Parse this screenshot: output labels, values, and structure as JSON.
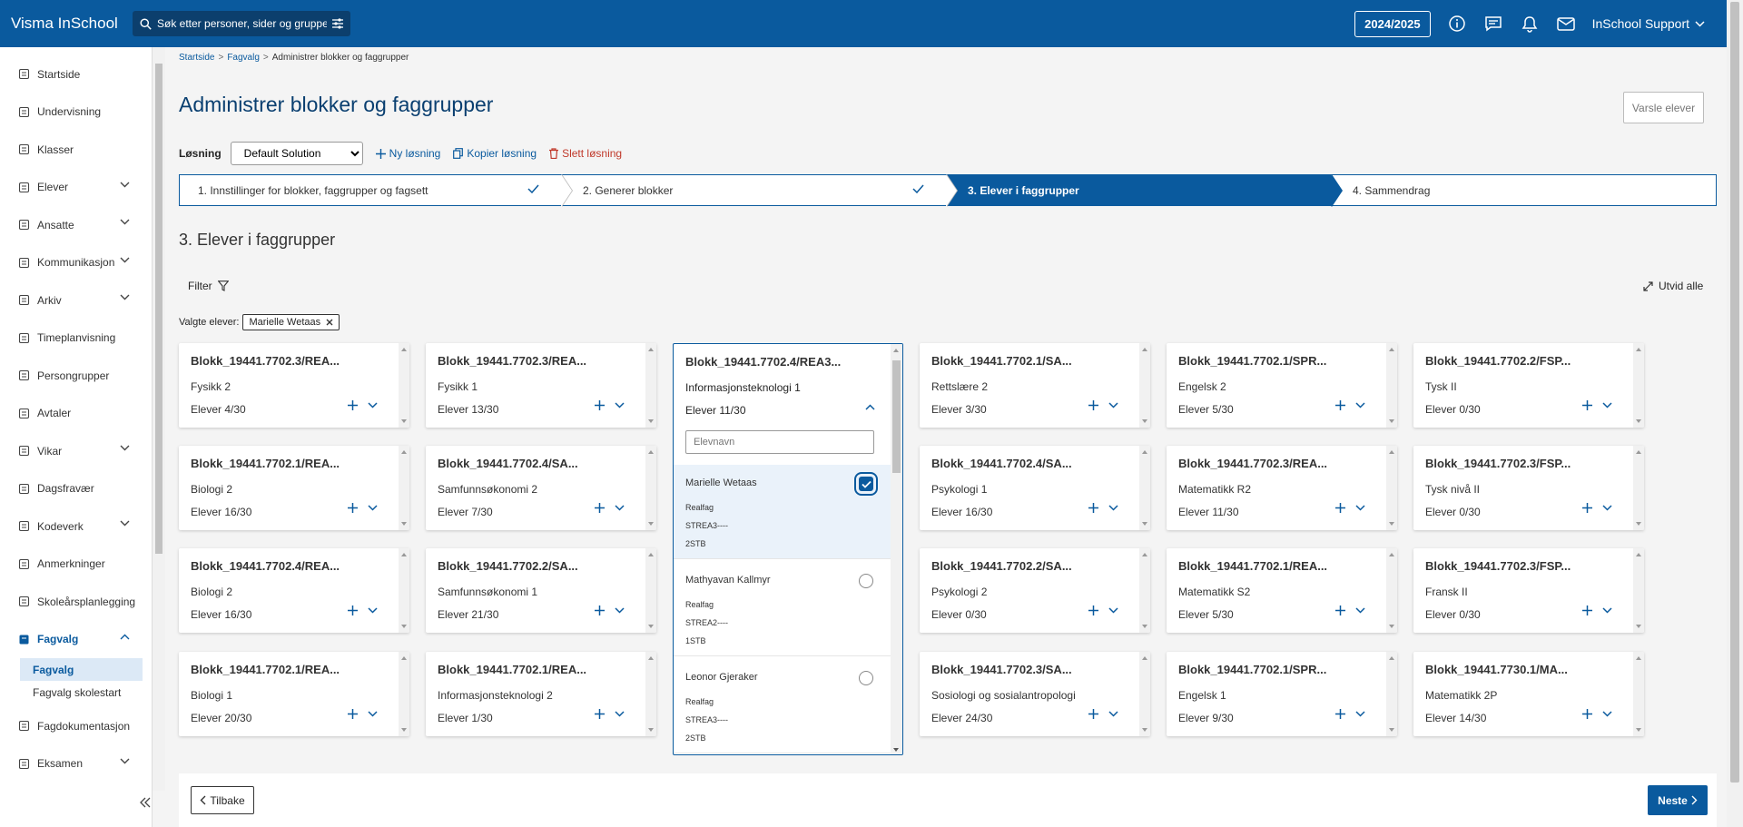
{
  "app": {
    "title": "Visma InSchool",
    "search_placeholder": "Søk etter personer, sider og grupper",
    "year": "2024/2025",
    "user": "InSchool Support"
  },
  "sidebar": {
    "items": [
      {
        "label": "Startside",
        "icon": "flag-icon",
        "chevron": false
      },
      {
        "label": "Undervisning",
        "icon": "book-icon",
        "chevron": false
      },
      {
        "label": "Klasser",
        "icon": "class-icon",
        "chevron": false
      },
      {
        "label": "Elever",
        "icon": "student-icon",
        "chevron": true
      },
      {
        "label": "Ansatte",
        "icon": "briefcase-icon",
        "chevron": true
      },
      {
        "label": "Kommunikasjon",
        "icon": "chat-icon",
        "chevron": true
      },
      {
        "label": "Arkiv",
        "icon": "archive-icon",
        "chevron": true
      },
      {
        "label": "Timeplanvisning",
        "icon": "calendar-icon",
        "chevron": false
      },
      {
        "label": "Persongrupper",
        "icon": "group-icon",
        "chevron": false
      },
      {
        "label": "Avtaler",
        "icon": "calendar-check-icon",
        "chevron": false
      },
      {
        "label": "Vikar",
        "icon": "swap-icon",
        "chevron": true
      },
      {
        "label": "Dagsfravær",
        "icon": "person-icon",
        "chevron": false
      },
      {
        "label": "Kodeverk",
        "icon": "code-icon",
        "chevron": true
      },
      {
        "label": "Anmerkninger",
        "icon": "hand-icon",
        "chevron": false
      },
      {
        "label": "Skoleårsplanlegging",
        "icon": "planner-icon",
        "chevron": false
      }
    ],
    "fagvalg": {
      "label": "Fagvalg",
      "subs": [
        "Fagvalg",
        "Fagvalg skolestart"
      ]
    },
    "after": [
      {
        "label": "Fagdokumentasjon",
        "icon": "document-icon",
        "chevron": false
      },
      {
        "label": "Eksamen",
        "icon": "exam-icon",
        "chevron": true
      }
    ]
  },
  "breadcrumb": [
    "Startside",
    "Fagvalg",
    "Administrer blokker og faggrupper"
  ],
  "page": {
    "title": "Administrer blokker og faggrupper",
    "varsle": "Varsle elever",
    "section": "3. Elever i faggrupper",
    "filter": "Filter",
    "expand": "Utvid alle",
    "valgte_label": "Valgte elever:",
    "valgte_chip": "Marielle Wetaas"
  },
  "solution": {
    "label": "Løsning",
    "value": "Default Solution",
    "new": "Ny løsning",
    "copy": "Kopier løsning",
    "delete": "Slett løsning"
  },
  "steps": [
    {
      "label": "1. Innstillinger for blokker, faggrupper og fagsett",
      "done": true
    },
    {
      "label": "2. Generer blokker",
      "done": true
    },
    {
      "label": "3. Elever i faggrupper",
      "done": false
    },
    {
      "label": "4. Sammendrag",
      "done": false
    }
  ],
  "cards": [
    [
      {
        "title": "Blokk_19441.7702.3/REA...",
        "subject": "Fysikk 2",
        "count": "Elever 4/30"
      },
      {
        "title": "Blokk_19441.7702.1/REA...",
        "subject": "Biologi 2",
        "count": "Elever 16/30"
      },
      {
        "title": "Blokk_19441.7702.4/REA...",
        "subject": "Biologi 2",
        "count": "Elever 16/30"
      },
      {
        "title": "Blokk_19441.7702.1/REA...",
        "subject": "Biologi 1",
        "count": "Elever 20/30"
      }
    ],
    [
      {
        "title": "Blokk_19441.7702.3/REA...",
        "subject": "Fysikk 1",
        "count": "Elever 13/30"
      },
      {
        "title": "Blokk_19441.7702.4/SA...",
        "subject": "Samfunnsøkonomi 2",
        "count": "Elever 7/30"
      },
      {
        "title": "Blokk_19441.7702.2/SA...",
        "subject": "Samfunnsøkonomi 1",
        "count": "Elever 21/30"
      },
      {
        "title": "Blokk_19441.7702.1/REA...",
        "subject": "Informasjonsteknologi 2",
        "count": "Elever 1/30"
      }
    ],
    [],
    [
      {
        "title": "Blokk_19441.7702.1/SA...",
        "subject": "Rettslære 2",
        "count": "Elever 3/30"
      },
      {
        "title": "Blokk_19441.7702.4/SA...",
        "subject": "Psykologi 1",
        "count": "Elever 16/30"
      },
      {
        "title": "Blokk_19441.7702.2/SA...",
        "subject": "Psykologi 2",
        "count": "Elever 0/30"
      },
      {
        "title": "Blokk_19441.7702.3/SA...",
        "subject": "Sosiologi og sosialantropologi",
        "count": "Elever 24/30"
      }
    ],
    [
      {
        "title": "Blokk_19441.7702.1/SPR...",
        "subject": "Engelsk 2",
        "count": "Elever 5/30"
      },
      {
        "title": "Blokk_19441.7702.3/REA...",
        "subject": "Matematikk R2",
        "count": "Elever 11/30"
      },
      {
        "title": "Blokk_19441.7702.1/REA...",
        "subject": "Matematikk S2",
        "count": "Elever 5/30"
      },
      {
        "title": "Blokk_19441.7702.1/SPR...",
        "subject": "Engelsk 1",
        "count": "Elever 9/30"
      }
    ],
    [
      {
        "title": "Blokk_19441.7702.2/FSP...",
        "subject": "Tysk II",
        "count": "Elever 0/30"
      },
      {
        "title": "Blokk_19441.7702.3/FSP...",
        "subject": "Tysk nivå II",
        "count": "Elever 0/30"
      },
      {
        "title": "Blokk_19441.7702.3/FSP...",
        "subject": "Fransk II",
        "count": "Elever 0/30"
      },
      {
        "title": "Blokk_19441.7730.1/MA...",
        "subject": "Matematikk 2P",
        "count": "Elever 14/30"
      }
    ]
  ],
  "open_card": {
    "title": "Blokk_19441.7702.4/REA3...",
    "subject": "Informasjonsteknologi 1",
    "count": "Elever 11/30",
    "search_placeholder": "Elevnavn",
    "students": [
      {
        "name": "Marielle Wetaas",
        "program": "Realfag",
        "code": "STREA3----",
        "class": "2STB",
        "checked": true
      },
      {
        "name": "Mathyavan Kallmyr",
        "program": "Realfag",
        "code": "STREA2----",
        "class": "1STB",
        "checked": false
      },
      {
        "name": "Leonor Gjeraker",
        "program": "Realfag",
        "code": "STREA3----",
        "class": "2STB",
        "checked": false
      }
    ]
  },
  "footer": {
    "back": "Tilbake",
    "next": "Neste"
  },
  "colors": {
    "primary": "#0a5a9e",
    "danger": "#c0392b"
  }
}
